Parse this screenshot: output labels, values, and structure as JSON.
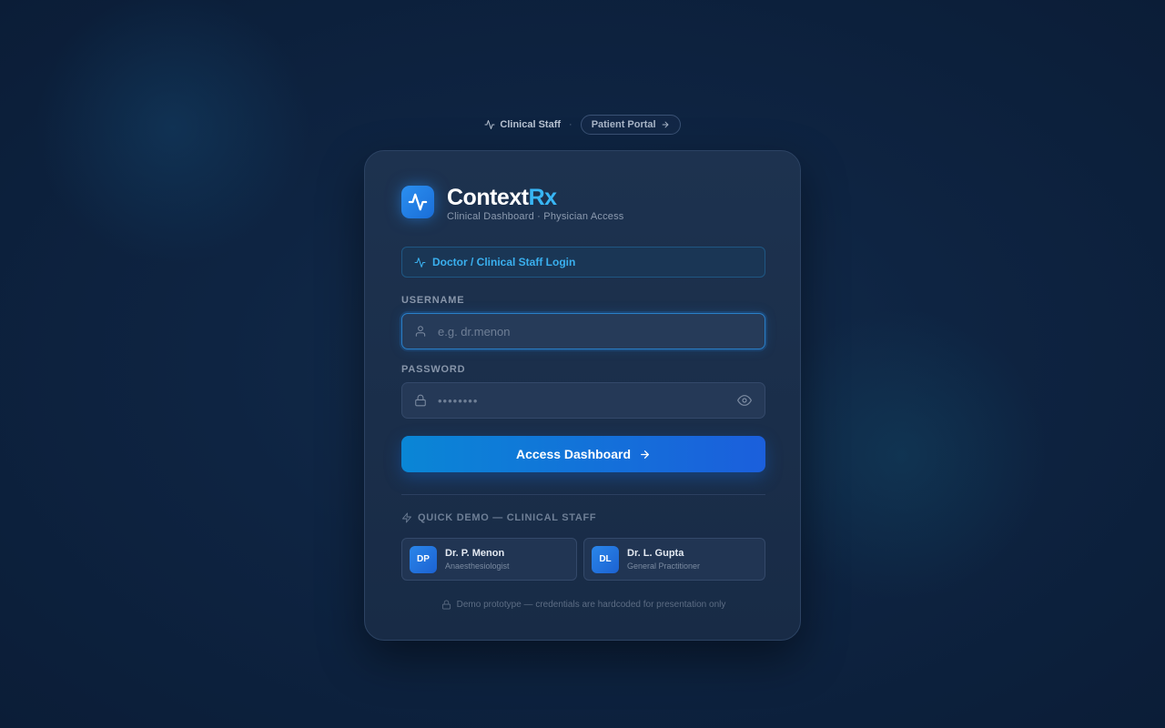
{
  "topbar": {
    "staff_label": "Clinical Staff",
    "separator": "·",
    "portal_label": "Patient Portal"
  },
  "brand": {
    "name_main": "Context",
    "name_accent": "Rx",
    "subtitle": "Clinical Dashboard · Physician Access"
  },
  "role_banner": {
    "label": "Doctor / Clinical Staff Login"
  },
  "form": {
    "username_label": "USERNAME",
    "username_placeholder": "e.g. dr.menon",
    "password_label": "PASSWORD",
    "password_placeholder": "••••••••",
    "submit_label": "Access Dashboard"
  },
  "demo": {
    "title": "QUICK DEMO — CLINICAL STAFF",
    "accounts": [
      {
        "initials": "DP",
        "name": "Dr. P. Menon",
        "role": "Anaesthesiologist"
      },
      {
        "initials": "DL",
        "name": "Dr. L. Gupta",
        "role": "General Practitioner"
      }
    ]
  },
  "footnote": "Demo prototype — credentials are hardcoded for presentation only",
  "colors": {
    "accent": "#38b6f5",
    "button_start": "#0a86d6",
    "button_end": "#1b5fdc",
    "background": "#0e2442"
  },
  "icons": {
    "staff": "activity-icon",
    "portal": "arrow-right-icon",
    "logo": "activity-icon",
    "username": "user-icon",
    "password": "lock-icon",
    "reveal": "eye-icon",
    "demo": "zap-icon",
    "footnote": "lock-icon"
  }
}
